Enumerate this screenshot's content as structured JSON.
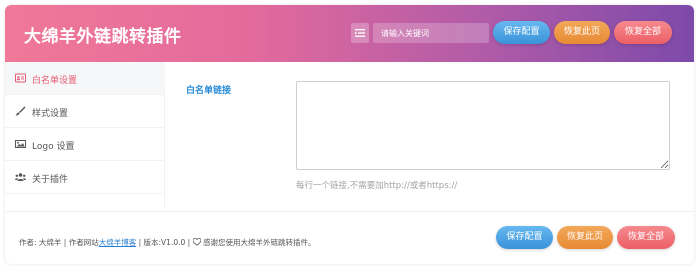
{
  "header": {
    "title": "大绵羊外链跳转插件",
    "search_placeholder": "请输入关键词",
    "save_label": "保存配置",
    "restore_page_label": "恢复此页",
    "restore_all_label": "恢复全部"
  },
  "sidebar": {
    "items": [
      {
        "label": "白名单设置",
        "icon": "id-card-icon",
        "active": true
      },
      {
        "label": "样式设置",
        "icon": "brush-icon",
        "active": false
      },
      {
        "label": "Logo 设置",
        "icon": "image-icon",
        "active": false
      },
      {
        "label": "关于插件",
        "icon": "users-icon",
        "active": false
      }
    ]
  },
  "main": {
    "field_label": "白名单链接",
    "textarea_value": "",
    "hint": "每行一个链接,不需要加http://或者https://"
  },
  "footer": {
    "author_prefix": "作者: 大绵羊 | 作者网站",
    "author_link": "大绵羊博客",
    "version_text": " | 版本:V1.0.0 | ",
    "thanks": " 感谢您使用大绵羊外链跳转插件。",
    "save_label": "保存配置",
    "restore_page_label": "恢复此页",
    "restore_all_label": "恢复全部"
  },
  "colors": {
    "accent_blue": "#3a92d8",
    "accent_orange": "#e78a34",
    "accent_red": "#ec5f66",
    "active_nav": "#e65a6f"
  }
}
